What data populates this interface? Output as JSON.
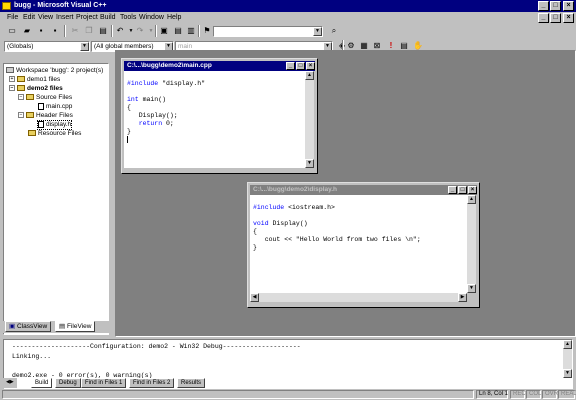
{
  "window": {
    "title": "bugg - Microsoft Visual C++"
  },
  "menu": [
    "File",
    "Edit",
    "View",
    "Insert",
    "Project",
    "Build",
    "Tools",
    "Window",
    "Help"
  ],
  "toolbar": {
    "find_combo_value": "",
    "globals_combo": "(Globals)",
    "members_combo": "(All global members)",
    "function_combo": "main"
  },
  "workspace": {
    "root": "Workspace 'bugg': 2 project(s)",
    "items": [
      {
        "label": "demo1 files"
      },
      {
        "label": "demo2 files"
      },
      {
        "label": "Source Files"
      },
      {
        "label": "main.cpp"
      },
      {
        "label": "Header Files"
      },
      {
        "label": "display.h"
      },
      {
        "label": "Resource Files"
      }
    ],
    "tabs": [
      "ClassView",
      "FileView"
    ]
  },
  "editor1": {
    "title": "C:\\...\\bugg\\demo2\\main.cpp",
    "lines": [
      "#include \"display.h\"",
      "",
      "int main()",
      "{",
      "   Display();",
      "   return 0;",
      "}"
    ]
  },
  "editor2": {
    "title": "C:\\...\\bugg\\demo2\\display.h",
    "lines": [
      "#include <iostream.h>",
      "",
      "void Display()",
      "{",
      "   cout << \"Hello World from two files \\n\";",
      "}"
    ]
  },
  "output": {
    "lines": [
      "--------------------Configuration: demo2 - Win32 Debug--------------------",
      "Linking...",
      "",
      "demo2.exe - 0 error(s), 0 warning(s)"
    ],
    "tabs": [
      "Build",
      "Debug",
      "Find in Files 1",
      "Find in Files 2",
      "Results"
    ]
  },
  "status": {
    "position": "Ln 8, Col 1",
    "indicators": [
      "REC",
      "COL",
      "OVR",
      "READ"
    ]
  }
}
